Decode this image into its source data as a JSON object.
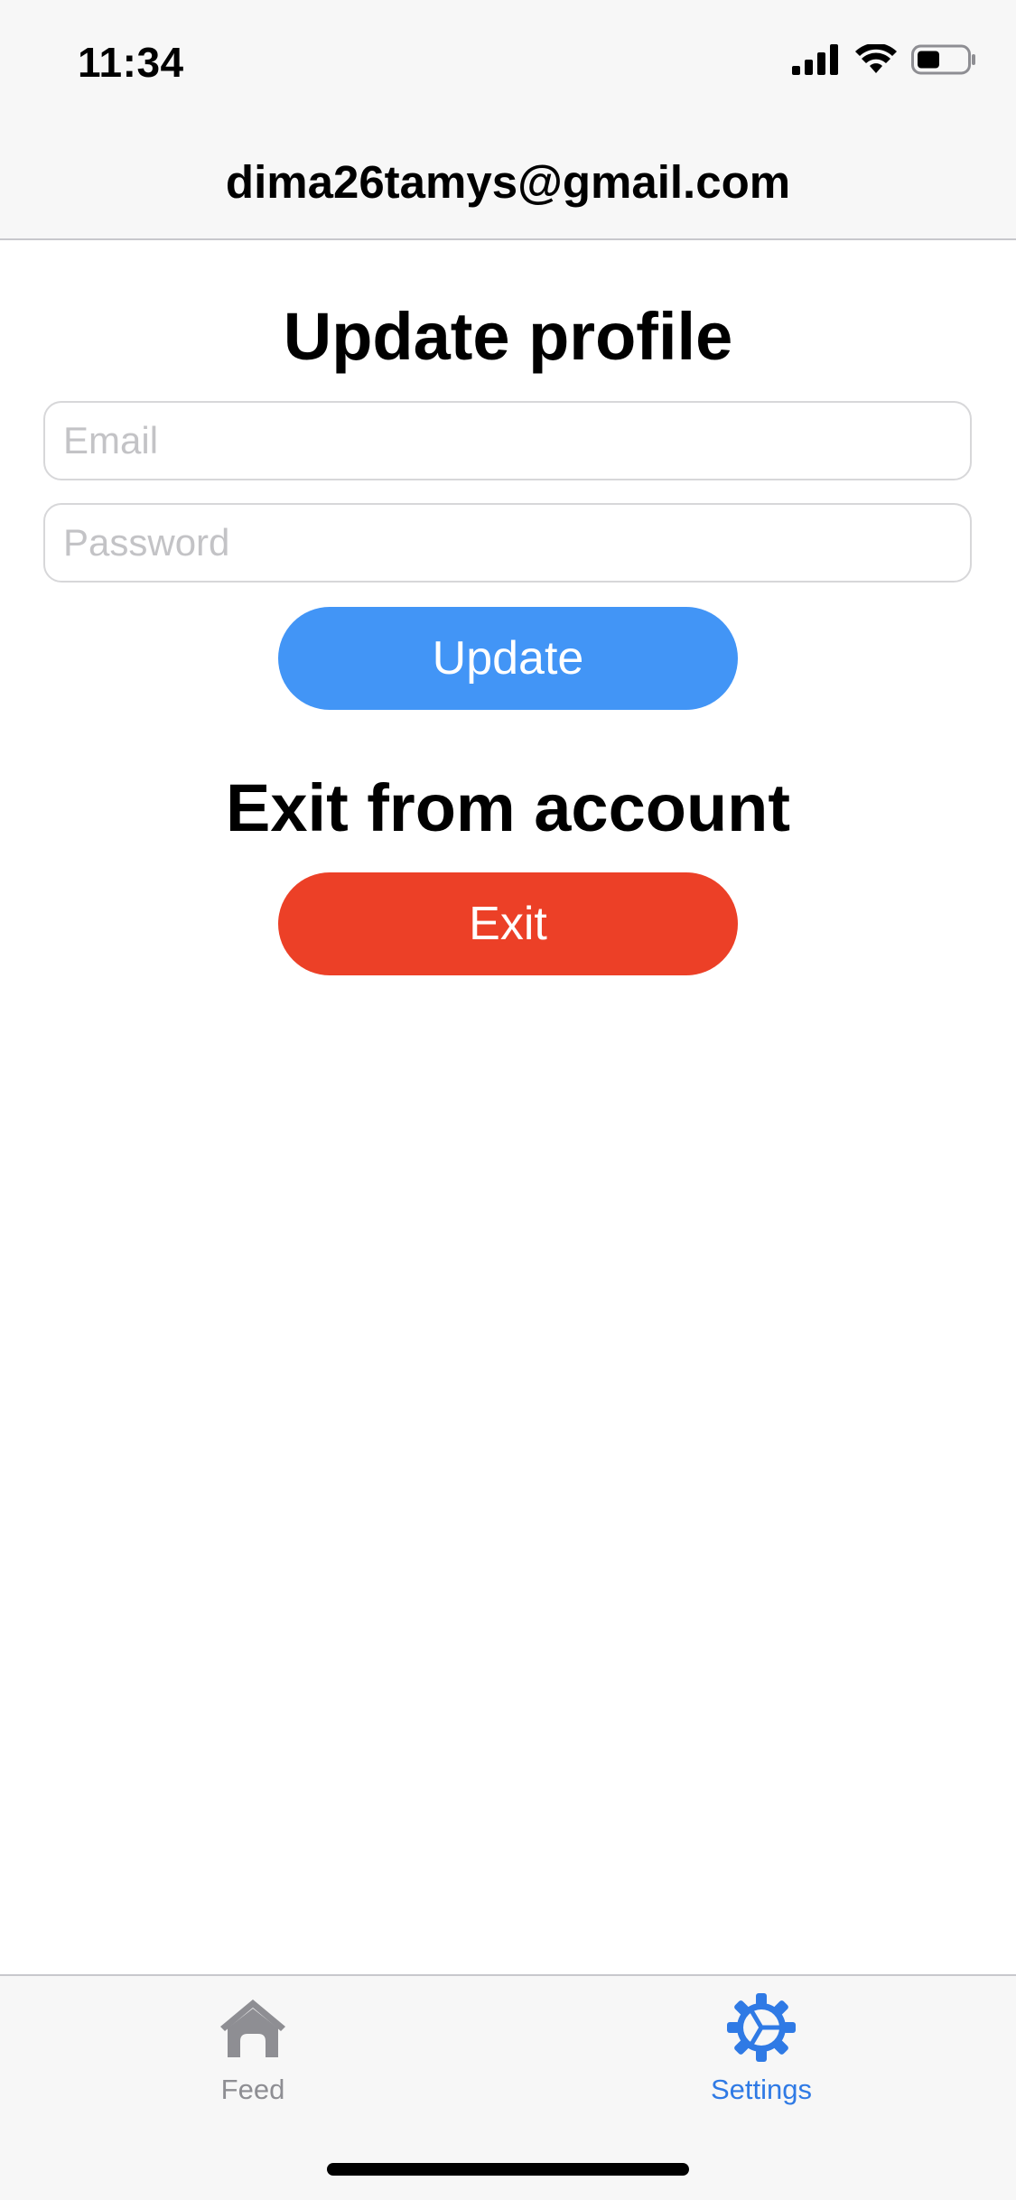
{
  "status_bar": {
    "time": "11:34",
    "icons": [
      "cellular-signal-icon",
      "wifi-icon",
      "battery-icon"
    ]
  },
  "nav": {
    "title": "dima26tamys@gmail.com"
  },
  "update_section": {
    "title": "Update profile",
    "email_placeholder": "Email",
    "email_value": "",
    "password_placeholder": "Password",
    "password_value": "",
    "button_label": "Update",
    "button_color": "#4295f6"
  },
  "exit_section": {
    "title": "Exit from account",
    "button_label": "Exit",
    "button_color": "#ec4027"
  },
  "tab_bar": {
    "tabs": [
      {
        "label": "Feed",
        "icon": "home-icon",
        "active": false,
        "color": "#8e8e93"
      },
      {
        "label": "Settings",
        "icon": "gear-icon",
        "active": true,
        "color": "#2f7ae5"
      }
    ]
  }
}
